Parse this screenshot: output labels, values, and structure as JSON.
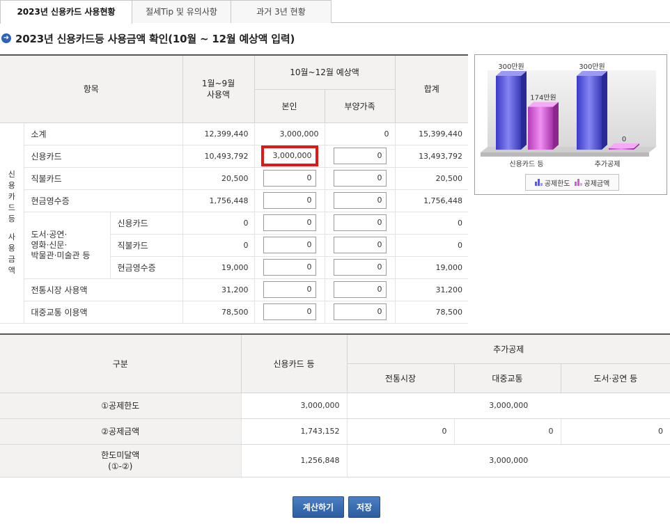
{
  "tabs": [
    {
      "label": "2023년 신용카드 사용현황"
    },
    {
      "label": "절세Tip 및 유의사항"
    },
    {
      "label": "과거 3년 현황"
    }
  ],
  "section_title": "2023년 신용카드등 사용금액 확인(10월 ~ 12월 예상액 입력)",
  "table1": {
    "headers": {
      "item": "항목",
      "jan_sep": "1월~9월\n사용액",
      "oct_dec": "10월~12월 예상액",
      "self": "본인",
      "dependents": "부양가족",
      "total": "합계"
    },
    "side_label": "신용카드등 사용금액",
    "culture_label": "도서·공연·\n영화·신문·\n박물관·미술관 등",
    "rows": [
      {
        "label": "소계",
        "jan_sep": "12,399,440",
        "self": "3,000,000",
        "dep": "0",
        "total": "15,399,440"
      },
      {
        "label": "신용카드",
        "jan_sep": "10,493,792",
        "self": "3,000,000",
        "dep": "0",
        "total": "13,493,792"
      },
      {
        "label": "직불카드",
        "jan_sep": "20,500",
        "self": "0",
        "dep": "0",
        "total": "20,500"
      },
      {
        "label": "현금영수증",
        "jan_sep": "1,756,448",
        "self": "0",
        "dep": "0",
        "total": "1,756,448"
      },
      {
        "label": "신용카드",
        "jan_sep": "0",
        "self": "0",
        "dep": "0",
        "total": "0"
      },
      {
        "label": "직불카드",
        "jan_sep": "0",
        "self": "0",
        "dep": "0",
        "total": "0"
      },
      {
        "label": "현금영수증",
        "jan_sep": "19,000",
        "self": "0",
        "dep": "0",
        "total": "19,000"
      },
      {
        "label": "전통시장 사용액",
        "jan_sep": "31,200",
        "self": "0",
        "dep": "0",
        "total": "31,200"
      },
      {
        "label": "대중교통 이용액",
        "jan_sep": "78,500",
        "self": "0",
        "dep": "0",
        "total": "78,500"
      }
    ]
  },
  "chart": {
    "categories": [
      "신용카드 등",
      "추가공제"
    ],
    "limit_labels": [
      "300만원",
      "300만원"
    ],
    "amount_labels": [
      "174만원",
      "0"
    ],
    "limit_values": [
      300,
      300
    ],
    "amount_values": [
      174,
      0
    ],
    "legend": [
      "공제한도",
      "공제금액"
    ],
    "colors": {
      "limit": "#5a5ae0",
      "amount": "#d45ad8"
    }
  },
  "table2": {
    "headers": {
      "category": "구분",
      "credit": "신용카드 등",
      "extra": "추가공제",
      "market": "전통시장",
      "transit": "대중교통",
      "culture": "도서·공연 등"
    },
    "rows": {
      "limit": {
        "label": "①공제한도",
        "credit": "3,000,000",
        "extra": "3,000,000"
      },
      "amount": {
        "label": "②공제금액",
        "credit": "1,743,152",
        "market": "0",
        "transit": "0",
        "culture": "0"
      },
      "remain": {
        "label": "한도미달액\n(①-②)",
        "credit": "1,256,848",
        "extra": "3,000,000"
      }
    }
  },
  "buttons": {
    "calc": "계산하기",
    "save": "저장"
  },
  "icons": {
    "section": "arrow-right-circle-icon",
    "legend": "bar-chart-icon"
  }
}
